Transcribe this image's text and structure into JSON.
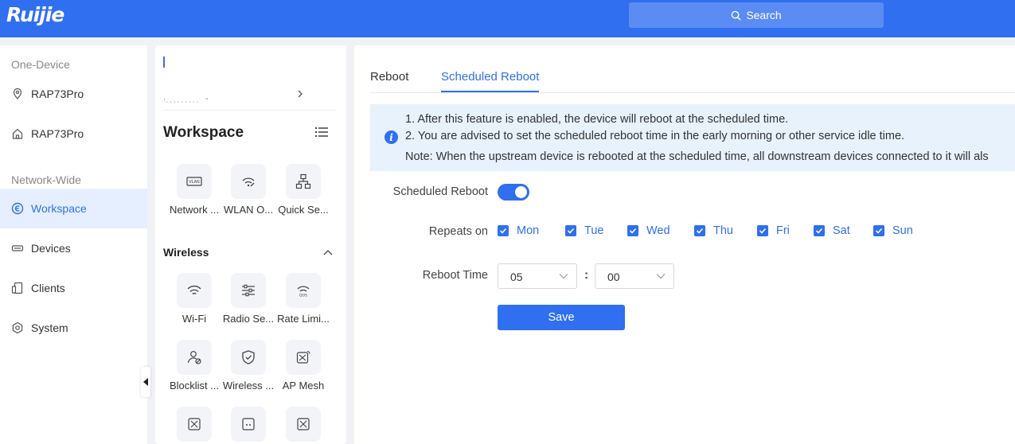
{
  "header": {
    "logo": "Ruijie",
    "search_label": "Search"
  },
  "leftnav": {
    "section_one_device": "One-Device",
    "one_device_items": [
      {
        "label": "RAP73Pro",
        "icon": "location-pin-icon"
      },
      {
        "label": "RAP73Pro",
        "icon": "home-icon"
      }
    ],
    "section_network_wide": "Network-Wide",
    "network_items": [
      {
        "label": "Workspace",
        "icon": "workspace-icon",
        "active": true
      },
      {
        "label": "Devices",
        "icon": "devices-icon"
      },
      {
        "label": "Clients",
        "icon": "clients-icon"
      },
      {
        "label": "System",
        "icon": "system-icon"
      }
    ]
  },
  "midpanel": {
    "workspace_title": "Workspace",
    "top_tiles": [
      {
        "label": "Network ...",
        "icon": "vlan-icon"
      },
      {
        "label": "WLAN O...",
        "icon": "wlan-optimize-icon"
      },
      {
        "label": "Quick Se...",
        "icon": "network-topology-icon"
      }
    ],
    "wireless_title": "Wireless",
    "wireless_tiles": [
      {
        "label": "Wi-Fi",
        "icon": "wifi-icon"
      },
      {
        "label": "Radio Se...",
        "icon": "sliders-icon"
      },
      {
        "label": "Rate Limi...",
        "icon": "qos-icon"
      },
      {
        "label": "Blocklist ...",
        "icon": "user-block-icon"
      },
      {
        "label": "Wireless ...",
        "icon": "shield-icon"
      },
      {
        "label": "AP Mesh",
        "icon": "mesh-icon"
      }
    ]
  },
  "main": {
    "tabs": [
      {
        "label": "Reboot",
        "active": false
      },
      {
        "label": "Scheduled Reboot",
        "active": true
      }
    ],
    "info_lines": [
      "1. After this feature is enabled, the device will reboot at the scheduled time.",
      "2. You are advised to set the scheduled reboot time in the early morning or other service idle time.",
      "Note: When the upstream device is rebooted at the scheduled time, all downstream devices connected to it will als"
    ],
    "scheduled_reboot_label": "Scheduled Reboot",
    "scheduled_reboot_enabled": true,
    "repeats_on_label": "Repeats on",
    "days": [
      {
        "label": "Mon",
        "checked": true
      },
      {
        "label": "Tue",
        "checked": true
      },
      {
        "label": "Wed",
        "checked": true
      },
      {
        "label": "Thu",
        "checked": true
      },
      {
        "label": "Fri",
        "checked": true
      },
      {
        "label": "Sat",
        "checked": true
      },
      {
        "label": "Sun",
        "checked": true
      }
    ],
    "reboot_time_label": "Reboot Time",
    "hour": "05",
    "separator": ":",
    "minute": "00",
    "save_label": "Save"
  },
  "colors": {
    "primary": "#2f6ff0",
    "header_bg": "#2f6ff0",
    "info_bg": "#e7f2fd",
    "active_nav_bg": "#e6efff"
  }
}
